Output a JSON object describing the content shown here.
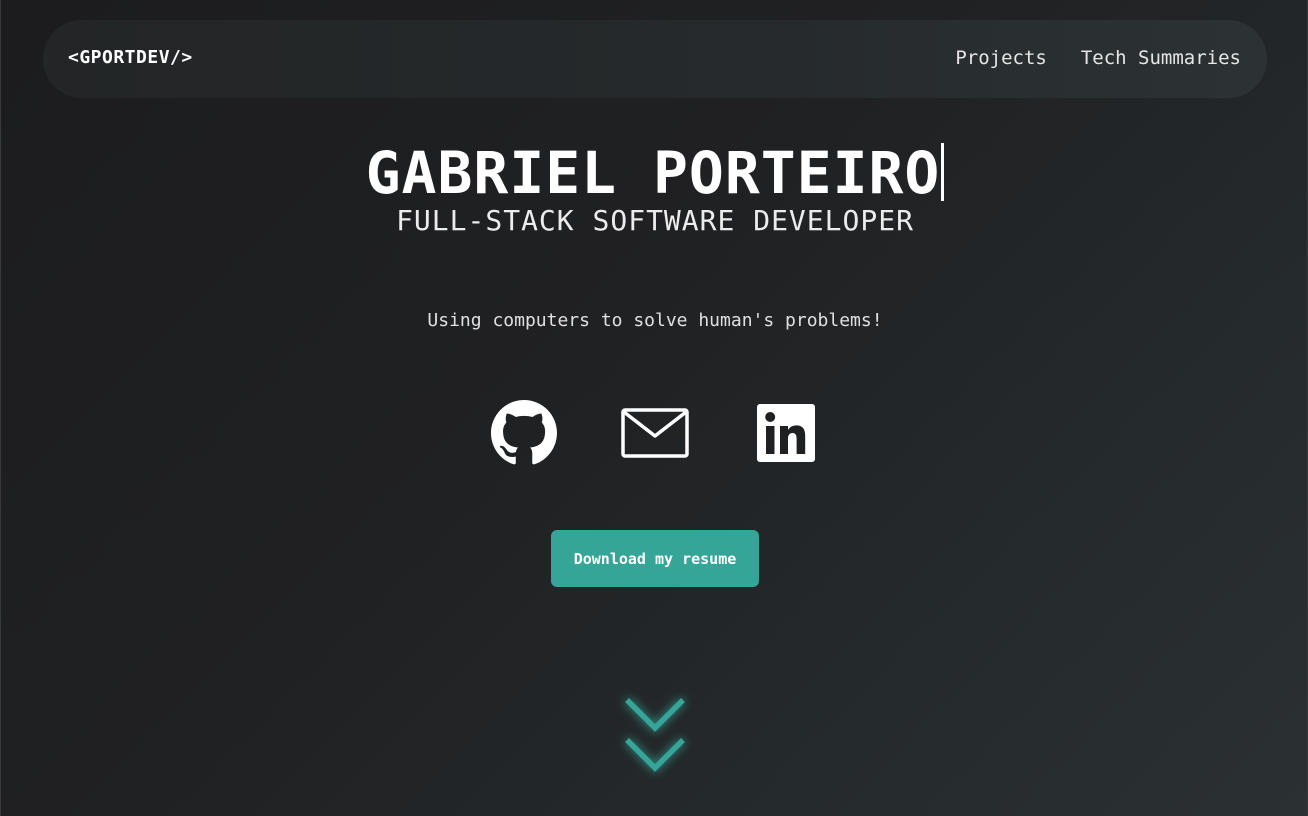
{
  "navbar": {
    "brand": "<GPORTDEV/>",
    "links": [
      "Projects",
      "Tech Summaries"
    ]
  },
  "hero": {
    "name": "GABRIEL PORTEIRO",
    "role": "FULL-STACK SOFTWARE DEVELOPER",
    "tagline": "Using computers to solve human's problems!"
  },
  "social": {
    "icons": [
      "github-icon",
      "mail-icon",
      "linkedin-icon"
    ]
  },
  "resume_button": {
    "label": "Download my resume"
  },
  "colors": {
    "accent": "#35a597",
    "background": "#1f2022",
    "navbar": "#26292b",
    "text": "#ffffff"
  }
}
